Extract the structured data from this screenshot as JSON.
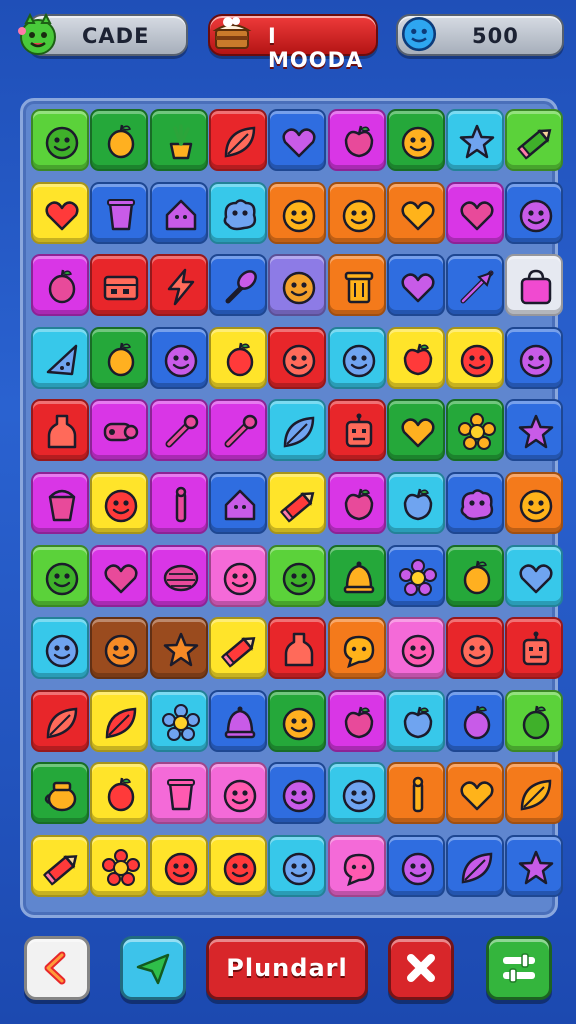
{
  "header": {
    "left_label": "CADE",
    "center_label": "I MOODA",
    "right_value": "500",
    "left_icon": "green-monster-icon",
    "center_icon": "cake-icon",
    "right_icon": "blue-smiley-icon"
  },
  "board": {
    "columns": 9,
    "rows": 11,
    "palette": {
      "lime": "#5bd23a",
      "green": "#25a83a",
      "red": "#e8262a",
      "blue": "#2f6de0",
      "magenta": "#d936e6",
      "yellow": "#ffe42a",
      "orange": "#f47a1b",
      "cyan": "#37c8ea",
      "pink": "#f46ad8",
      "purple": "#8d7be6",
      "brown": "#9a4b1e",
      "white": "#e6e9f1"
    },
    "tiles": [
      [
        "lime:face",
        "green:fruit",
        "green:plant",
        "red:leaf",
        "blue:heart",
        "magenta:apple",
        "green:face",
        "cyan:star",
        "lime:pencil"
      ],
      [
        "yellow:heart",
        "blue:cup",
        "blue:house",
        "cyan:blob",
        "orange:face",
        "orange:face",
        "orange:heart",
        "magenta:heart",
        "blue:face"
      ],
      [
        "magenta:fruit",
        "red:box",
        "red:bolt",
        "blue:brush",
        "purple:face",
        "orange:bin",
        "blue:heart",
        "blue:arrow",
        "white:bag"
      ],
      [
        "cyan:slice",
        "green:fruit",
        "blue:face",
        "yellow:fruit",
        "red:face",
        "cyan:face",
        "yellow:apple",
        "yellow:face",
        "blue:face"
      ],
      [
        "red:bottle",
        "magenta:cannon",
        "magenta:tool",
        "magenta:tool",
        "cyan:leaf",
        "red:robot",
        "green:heart",
        "green:flower",
        "blue:star"
      ],
      [
        "magenta:bucket",
        "yellow:face",
        "magenta:stick",
        "blue:house",
        "yellow:pencil",
        "magenta:apple",
        "cyan:apple",
        "blue:blob",
        "orange:face"
      ],
      [
        "lime:face",
        "magenta:heart",
        "magenta:ball",
        "pink:face",
        "lime:face",
        "green:bell",
        "blue:flower",
        "green:fruit",
        "cyan:heart"
      ],
      [
        "cyan:face",
        "brown:face",
        "brown:star",
        "yellow:pencil",
        "red:bottle",
        "orange:bubble",
        "pink:face",
        "red:face",
        "red:robot"
      ],
      [
        "red:leaf",
        "yellow:leaf",
        "cyan:flower",
        "blue:bell",
        "green:face",
        "magenta:apple",
        "cyan:apple",
        "blue:fruit",
        "lime:fruit"
      ],
      [
        "green:pot",
        "yellow:fruit",
        "pink:cup",
        "pink:face",
        "blue:face",
        "cyan:face",
        "orange:stick",
        "orange:heart",
        "orange:leaf"
      ],
      [
        "yellow:pencil",
        "yellow:flower",
        "yellow:face",
        "yellow:face",
        "cyan:face",
        "pink:bubble",
        "blue:face",
        "blue:leaf",
        "blue:star"
      ]
    ]
  },
  "footer": {
    "back_icon": "chevron-left-icon",
    "send_icon": "paper-plane-icon",
    "play_label": "Plundarl",
    "close_icon": "close-x-icon",
    "menu_icon": "sliders-icon",
    "colors": {
      "back": "#f2f2f2",
      "send": "#3dc3ea",
      "play": "#d8262a",
      "close": "#d8262a",
      "menu": "#34b53d"
    }
  }
}
